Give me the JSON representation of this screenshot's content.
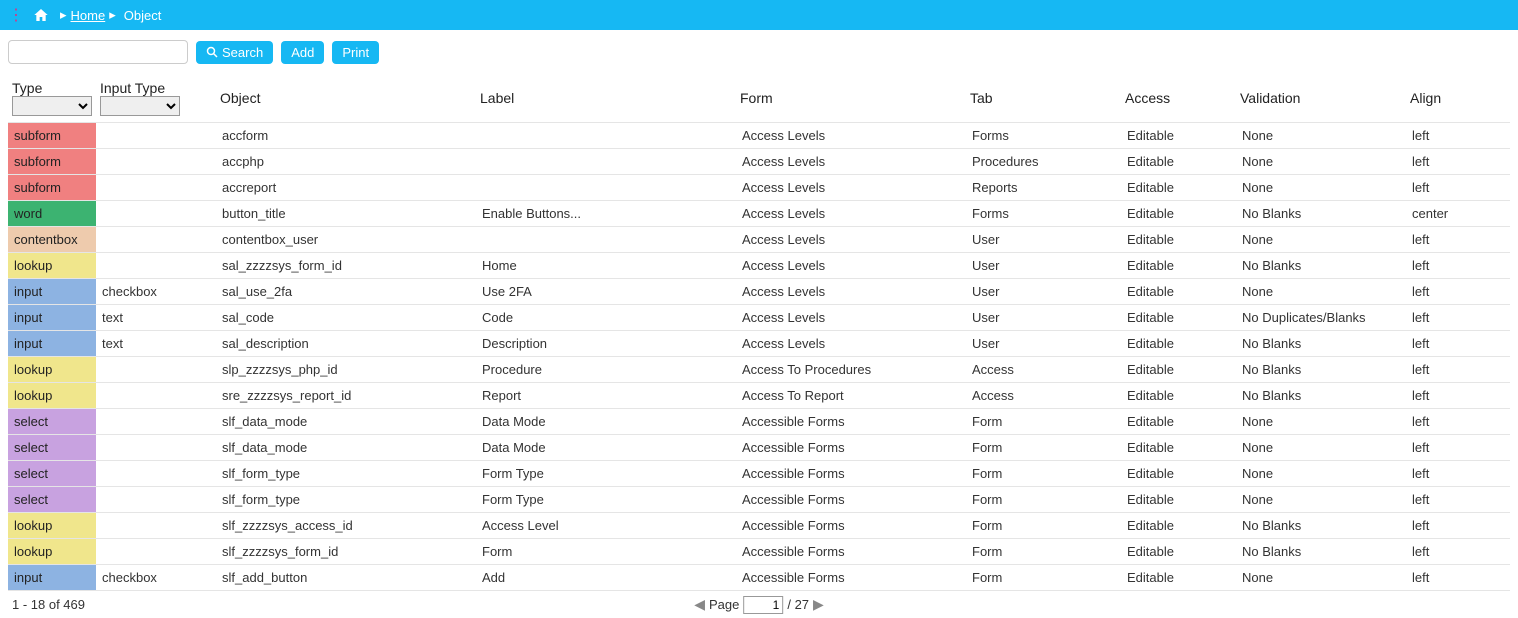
{
  "breadcrumb": {
    "home": "Home",
    "current": "Object"
  },
  "toolbar": {
    "search": "Search",
    "add": "Add",
    "print": "Print"
  },
  "columns": {
    "type": "Type",
    "inputType": "Input Type",
    "object": "Object",
    "label": "Label",
    "form": "Form",
    "tab": "Tab",
    "access": "Access",
    "validation": "Validation",
    "align": "Align"
  },
  "rows": [
    {
      "type": "subform",
      "typeClass": "type-subform",
      "inputType": "",
      "object": "accform",
      "label": "",
      "form": "Access Levels",
      "tab": "Forms",
      "access": "Editable",
      "validation": "None",
      "align": "left"
    },
    {
      "type": "subform",
      "typeClass": "type-subform",
      "inputType": "",
      "object": "accphp",
      "label": "",
      "form": "Access Levels",
      "tab": "Procedures",
      "access": "Editable",
      "validation": "None",
      "align": "left"
    },
    {
      "type": "subform",
      "typeClass": "type-subform",
      "inputType": "",
      "object": "accreport",
      "label": "",
      "form": "Access Levels",
      "tab": "Reports",
      "access": "Editable",
      "validation": "None",
      "align": "left"
    },
    {
      "type": "word",
      "typeClass": "type-word",
      "inputType": "",
      "object": "button_title",
      "label": "Enable Buttons...",
      "form": "Access Levels",
      "tab": "Forms",
      "access": "Editable",
      "validation": "No Blanks",
      "align": "center"
    },
    {
      "type": "contentbox",
      "typeClass": "type-contentbox",
      "inputType": "",
      "object": "contentbox_user",
      "label": "",
      "form": "Access Levels",
      "tab": "User",
      "access": "Editable",
      "validation": "None",
      "align": "left"
    },
    {
      "type": "lookup",
      "typeClass": "type-lookup",
      "inputType": "",
      "object": "sal_zzzzsys_form_id",
      "label": "Home",
      "form": "Access Levels",
      "tab": "User",
      "access": "Editable",
      "validation": "No Blanks",
      "align": "left"
    },
    {
      "type": "input",
      "typeClass": "type-input",
      "inputType": "checkbox",
      "object": "sal_use_2fa",
      "label": "Use 2FA",
      "form": "Access Levels",
      "tab": "User",
      "access": "Editable",
      "validation": "None",
      "align": "left"
    },
    {
      "type": "input",
      "typeClass": "type-input",
      "inputType": "text",
      "object": "sal_code",
      "label": "Code",
      "form": "Access Levels",
      "tab": "User",
      "access": "Editable",
      "validation": "No Duplicates/Blanks",
      "align": "left"
    },
    {
      "type": "input",
      "typeClass": "type-input",
      "inputType": "text",
      "object": "sal_description",
      "label": "Description",
      "form": "Access Levels",
      "tab": "User",
      "access": "Editable",
      "validation": "No Blanks",
      "align": "left"
    },
    {
      "type": "lookup",
      "typeClass": "type-lookup",
      "inputType": "",
      "object": "slp_zzzzsys_php_id",
      "label": "Procedure",
      "form": "Access To Procedures",
      "tab": "Access",
      "access": "Editable",
      "validation": "No Blanks",
      "align": "left"
    },
    {
      "type": "lookup",
      "typeClass": "type-lookup",
      "inputType": "",
      "object": "sre_zzzzsys_report_id",
      "label": "Report",
      "form": "Access To Report",
      "tab": "Access",
      "access": "Editable",
      "validation": "No Blanks",
      "align": "left"
    },
    {
      "type": "select",
      "typeClass": "type-select",
      "inputType": "",
      "object": "slf_data_mode",
      "label": "Data Mode",
      "form": "Accessible Forms",
      "tab": "Form",
      "access": "Editable",
      "validation": "None",
      "align": "left"
    },
    {
      "type": "select",
      "typeClass": "type-select",
      "inputType": "",
      "object": "slf_data_mode",
      "label": "Data Mode",
      "form": "Accessible Forms",
      "tab": "Form",
      "access": "Editable",
      "validation": "None",
      "align": "left"
    },
    {
      "type": "select",
      "typeClass": "type-select",
      "inputType": "",
      "object": "slf_form_type",
      "label": "Form Type",
      "form": "Accessible Forms",
      "tab": "Form",
      "access": "Editable",
      "validation": "None",
      "align": "left"
    },
    {
      "type": "select",
      "typeClass": "type-select",
      "inputType": "",
      "object": "slf_form_type",
      "label": "Form Type",
      "form": "Accessible Forms",
      "tab": "Form",
      "access": "Editable",
      "validation": "None",
      "align": "left"
    },
    {
      "type": "lookup",
      "typeClass": "type-lookup",
      "inputType": "",
      "object": "slf_zzzzsys_access_id",
      "label": "Access Level",
      "form": "Accessible Forms",
      "tab": "Form",
      "access": "Editable",
      "validation": "No Blanks",
      "align": "left"
    },
    {
      "type": "lookup",
      "typeClass": "type-lookup",
      "inputType": "",
      "object": "slf_zzzzsys_form_id",
      "label": "Form",
      "form": "Accessible Forms",
      "tab": "Form",
      "access": "Editable",
      "validation": "No Blanks",
      "align": "left"
    },
    {
      "type": "input",
      "typeClass": "type-input",
      "inputType": "checkbox",
      "object": "slf_add_button",
      "label": "Add",
      "form": "Accessible Forms",
      "tab": "Form",
      "access": "Editable",
      "validation": "None",
      "align": "left"
    }
  ],
  "footer": {
    "range": "1 - 18 of 469",
    "pageLabel": "Page",
    "page": "1",
    "totalPages": "/ 27"
  }
}
